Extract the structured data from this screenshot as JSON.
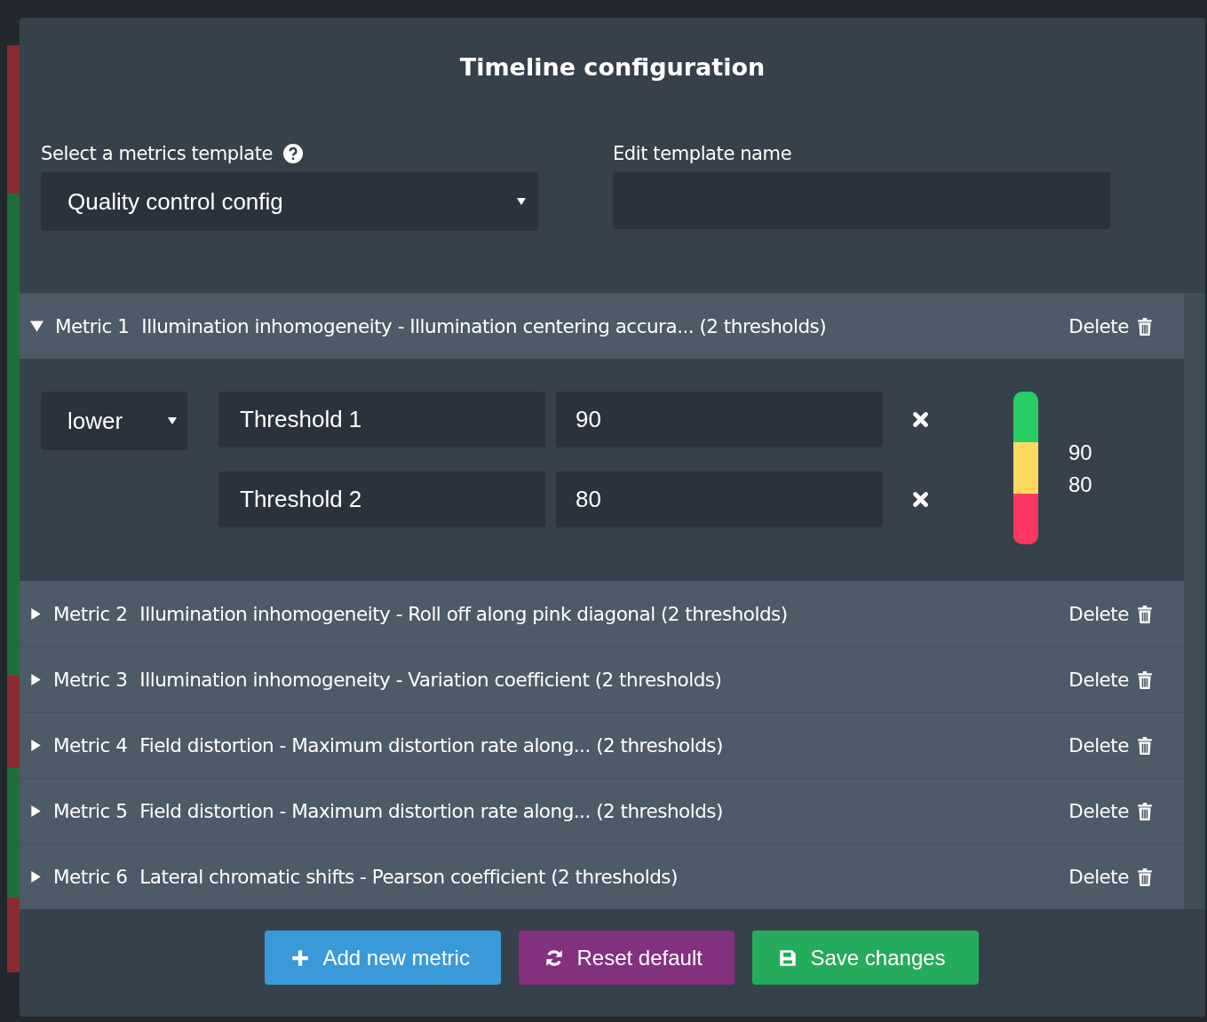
{
  "dialog": {
    "title": "Timeline configuration"
  },
  "template_select": {
    "label": "Select a metrics template",
    "value": "Quality control config"
  },
  "template_name": {
    "label": "Edit template name"
  },
  "metrics": [
    {
      "label": "Metric 1",
      "description": "Illumination inhomogeneity - Illumination centering accura... (2 thresholds)",
      "expanded": true,
      "delete": "Delete",
      "direction": "lower",
      "thresholds": [
        {
          "name": "Threshold 1",
          "value": "90"
        },
        {
          "name": "Threshold 2",
          "value": "80"
        }
      ],
      "gauge": {
        "segments": [
          {
            "color": "#27cc62"
          },
          {
            "color": "#fdd95f"
          },
          {
            "color": "#fd3762"
          }
        ],
        "labels": [
          "90",
          "80"
        ]
      }
    },
    {
      "label": "Metric 2",
      "description": "Illumination inhomogeneity - Roll off along pink diagonal (2 thresholds)",
      "expanded": false,
      "delete": "Delete"
    },
    {
      "label": "Metric 3",
      "description": "Illumination inhomogeneity - Variation coefficient (2 thresholds)",
      "expanded": false,
      "delete": "Delete"
    },
    {
      "label": "Metric 4",
      "description": "Field distortion - Maximum distortion rate along... (2 thresholds)",
      "expanded": false,
      "delete": "Delete"
    },
    {
      "label": "Metric 5",
      "description": "Field distortion - Maximum distortion rate along... (2 thresholds)",
      "expanded": false,
      "delete": "Delete"
    },
    {
      "label": "Metric 6",
      "description": "Lateral chromatic shifts - Pearson coefficient (2 thresholds)",
      "expanded": false,
      "delete": "Delete"
    }
  ],
  "buttons": [
    {
      "kind": "add",
      "label": "Add new metric"
    },
    {
      "kind": "reset",
      "label": "Reset default"
    },
    {
      "kind": "save",
      "label": "Save changes"
    }
  ]
}
